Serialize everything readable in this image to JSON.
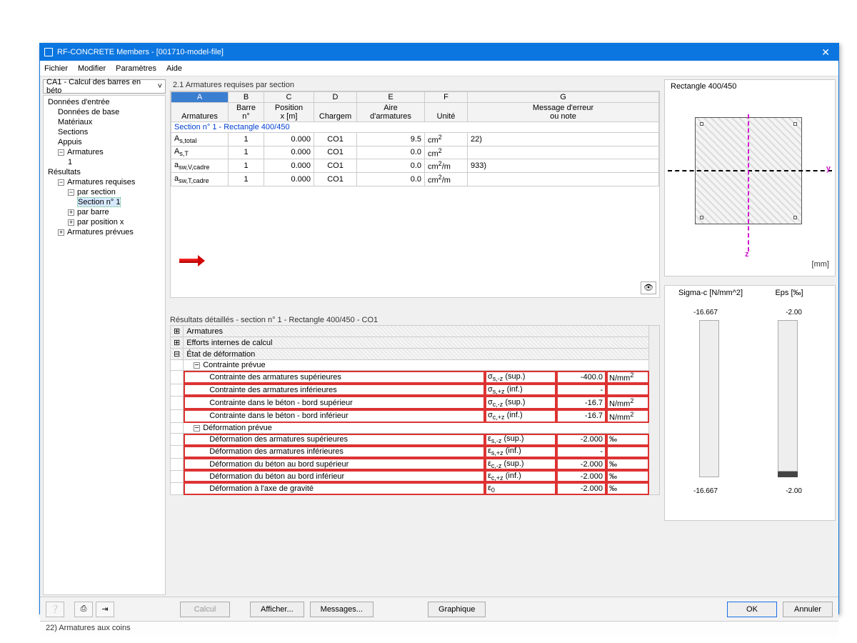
{
  "window": {
    "title": "RF-CONCRETE Members - [001710-model-file]"
  },
  "menu": {
    "file": "Fichier",
    "edit": "Modifier",
    "params": "Paramètres",
    "help": "Aide"
  },
  "combo": {
    "value": "CA1 - Calcul des barres en béto",
    "caret": "˅"
  },
  "tree": {
    "input": "Données d'entrée",
    "base": "Données de base",
    "materials": "Matériaux",
    "sections": "Sections",
    "supports": "Appuis",
    "reinf": "Armatures",
    "reinf1": "1",
    "results": "Résultats",
    "reqreinf": "Armatures requises",
    "bysection": "par section",
    "section1": "Section n° 1",
    "bybar": "par barre",
    "byposx": "par position x",
    "provided": "Armatures prévues"
  },
  "main": {
    "title": "2.1 Armatures requises par section",
    "letters": {
      "A": "A",
      "B": "B",
      "C": "C",
      "D": "D",
      "E": "E",
      "F": "F",
      "G": "G"
    },
    "hdr2": {
      "A": "Armatures",
      "B": "Barre\nn°",
      "C": "Position\nx [m]",
      "D": "Chargem",
      "E": "Aire\nd'armatures",
      "F": "Unité",
      "G": "Message d'erreur\nou note"
    },
    "sectionrow": "Section n° 1 - Rectangle 400/450",
    "rows": [
      {
        "a": "A_s,total",
        "b": "1",
        "c": "0.000",
        "d": "CO1",
        "e": "9.5",
        "f": "cm²",
        "g": "22)"
      },
      {
        "a": "A_s,T",
        "b": "1",
        "c": "0.000",
        "d": "CO1",
        "e": "0.0",
        "f": "cm²",
        "g": ""
      },
      {
        "a": "a_sw,V,cadre",
        "b": "1",
        "c": "0.000",
        "d": "CO1",
        "e": "0.0",
        "f": "cm²/m",
        "g": "933)"
      },
      {
        "a": "a_sw,T,cadre",
        "b": "1",
        "c": "0.000",
        "d": "CO1",
        "e": "0.0",
        "f": "cm²/m",
        "g": ""
      }
    ]
  },
  "details": {
    "title": "Résultats détaillés  -  section n° 1 - Rectangle 400/450  -  CO1",
    "groups": {
      "reinf": "Armatures",
      "internal": "Efforts internes de calcul",
      "deform": "État de déformation",
      "stress": "Contrainte prévue",
      "strain": "Déformation prévue"
    },
    "stress_rows": [
      {
        "l": "Contrainte des armatures supérieures",
        "s": "σ_s,-z (sup.)",
        "v": "-400.0",
        "u": "N/mm²"
      },
      {
        "l": "Contrainte des armatures inférieures",
        "s": "σ_s,+z (inf.)",
        "v": "-",
        "u": ""
      },
      {
        "l": "Contrainte dans le béton - bord supérieur",
        "s": "σ_c,-z (sup.)",
        "v": "-16.7",
        "u": "N/mm²"
      },
      {
        "l": "Contrainte dans le béton - bord inférieur",
        "s": "σ_c,+z (inf.)",
        "v": "-16.7",
        "u": "N/mm²"
      }
    ],
    "strain_rows": [
      {
        "l": "Déformation des armatures supérieures",
        "s": "ε_s,-z (sup.)",
        "v": "-2.000",
        "u": "‰"
      },
      {
        "l": "Déformation des armatures inférieures",
        "s": "ε_s,+z (inf.)",
        "v": "-",
        "u": ""
      },
      {
        "l": "Déformation du béton au bord supérieur",
        "s": "ε_c,-z (sup.)",
        "v": "-2.000",
        "u": "‰"
      },
      {
        "l": "Déformation du béton au bord inférieur",
        "s": "ε_c,+z (inf.)",
        "v": "-2.000",
        "u": "‰"
      },
      {
        "l": "Déformation à l'axe de gravité",
        "s": "ε_0",
        "v": "-2.000",
        "u": "‰"
      }
    ]
  },
  "preview": {
    "caption": "Rectangle 400/450",
    "unit": "[mm]",
    "y": "y",
    "z": "z",
    "sigma_head": "Sigma-c [N/mm^2]",
    "eps_head": "Eps [‰]",
    "sigma_top": "-16.667",
    "sigma_bot": "-16.667",
    "eps_top": "-2.00",
    "eps_bot": "-2.00"
  },
  "buttons": {
    "calc": "Calcul",
    "show": "Afficher...",
    "msgs": "Messages...",
    "graph": "Graphique",
    "ok": "OK",
    "cancel": "Annuler"
  },
  "status": "22) Armatures aux coins",
  "chart_data": {
    "type": "table",
    "title": "Contraintes et déformations prévues – section n°1 Rectangle 400/450 – CO1",
    "series": [
      {
        "name": "σ_s,-z (sup.) [N/mm²]",
        "values": [
          -400.0
        ]
      },
      {
        "name": "σ_c,-z (sup.) [N/mm²]",
        "values": [
          -16.7
        ]
      },
      {
        "name": "σ_c,+z (inf.) [N/mm²]",
        "values": [
          -16.7
        ]
      },
      {
        "name": "ε_s,-z (sup.) [‰]",
        "values": [
          -2.0
        ]
      },
      {
        "name": "ε_c,-z (sup.) [‰]",
        "values": [
          -2.0
        ]
      },
      {
        "name": "ε_c,+z (inf.) [‰]",
        "values": [
          -2.0
        ]
      },
      {
        "name": "ε_0 [‰]",
        "values": [
          -2.0
        ]
      }
    ]
  }
}
